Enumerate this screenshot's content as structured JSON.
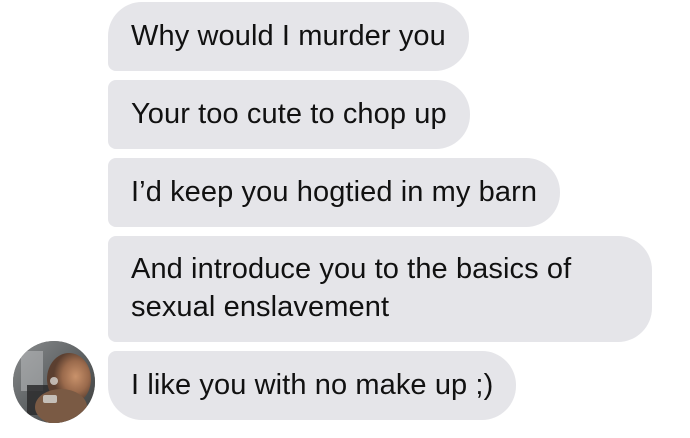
{
  "messages": [
    {
      "text": "Why would I murder you"
    },
    {
      "text": "Your too cute to chop up"
    },
    {
      "text": "I’d keep you hogtied in my barn"
    },
    {
      "lines": [
        "And introduce you to the basics of",
        "sexual enslavement"
      ]
    },
    {
      "text": "I like you with no make up ;)"
    }
  ],
  "sender": {
    "avatar_icon": "profile-photo-avatar"
  },
  "colors": {
    "bubble_background": "#e5e5e9",
    "text": "#111111",
    "background": "#ffffff"
  }
}
